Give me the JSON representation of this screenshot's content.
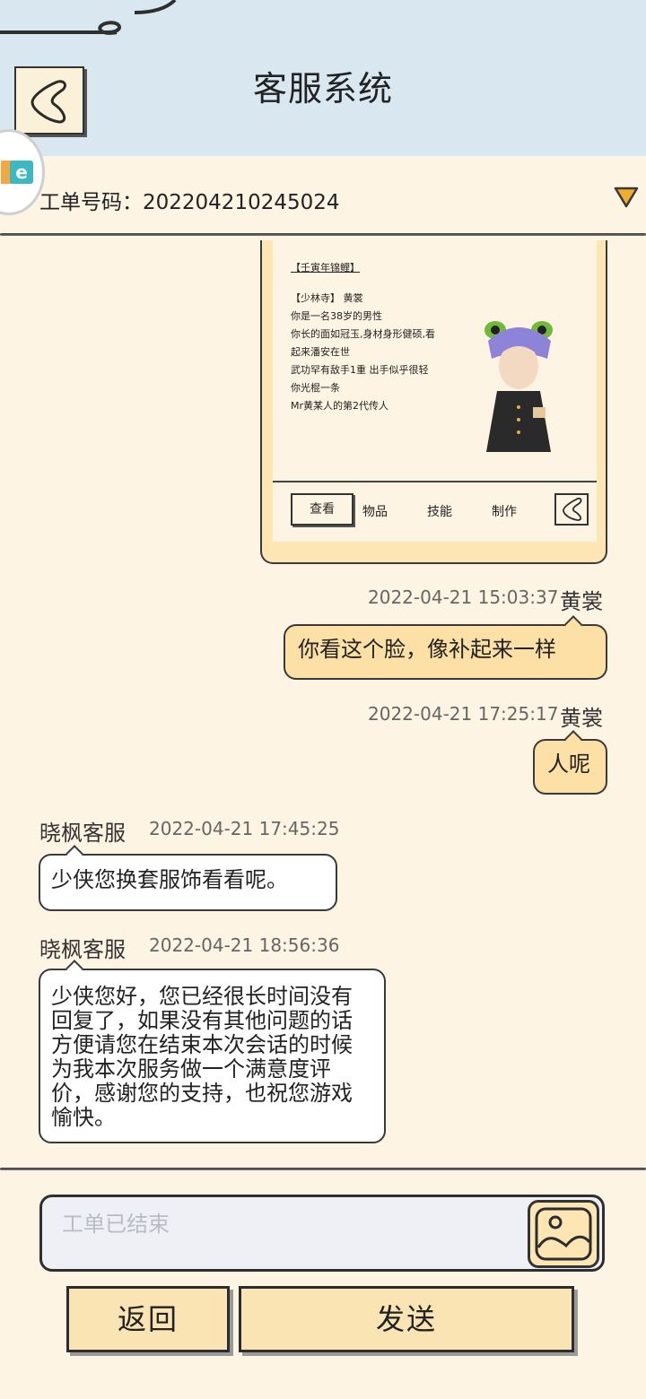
{
  "header": {
    "title": "客服系统"
  },
  "ticket": {
    "label": "工单号码：",
    "number": "202204210245024"
  },
  "screenshot_card": {
    "heading": "【壬寅年锦鲤】",
    "lines": [
      "【少林寺】 黄裳",
      "你是一名38岁的男性",
      "你长的面如冠玉,身材身形健硕,看",
      "起来潘安在世",
      "武功罕有敌手1重 出手似乎很轻",
      "你光棍一条",
      "Mr黄某人的第2代传人"
    ],
    "tabs": [
      "查看",
      "物品",
      "技能",
      "制作"
    ]
  },
  "messages": [
    {
      "sender": "黄裳",
      "time": "2022-04-21 15:03:37",
      "text": "你看这个脸，像补起来一样"
    },
    {
      "sender": "黄裳",
      "time": "2022-04-21 17:25:17",
      "text": "人呢"
    },
    {
      "sender": "晓枫客服",
      "time": "2022-04-21 17:45:25",
      "text": "少侠您换套服饰看看呢。"
    },
    {
      "sender": "晓枫客服",
      "time": "2022-04-21 18:56:36",
      "text": "少侠您好，您已经很长时间没有回复了，如果没有其他问题的话方便请您在结束本次会话的时候为我本次服务做一个满意度评价，感谢您的支持，也祝您游戏愉快。"
    }
  ],
  "composer": {
    "placeholder": "工单已结束"
  },
  "buttons": {
    "back": "返回",
    "send": "发送"
  },
  "colors": {
    "header_bg": "#d9e8f0",
    "page_bg": "#fdf4e4",
    "user_bubble": "#fde0a6",
    "agent_bubble": "#ffffff"
  },
  "icons": {
    "back": "back-chevron-icon",
    "dropdown": "triangle-down-icon",
    "image": "image-icon"
  }
}
